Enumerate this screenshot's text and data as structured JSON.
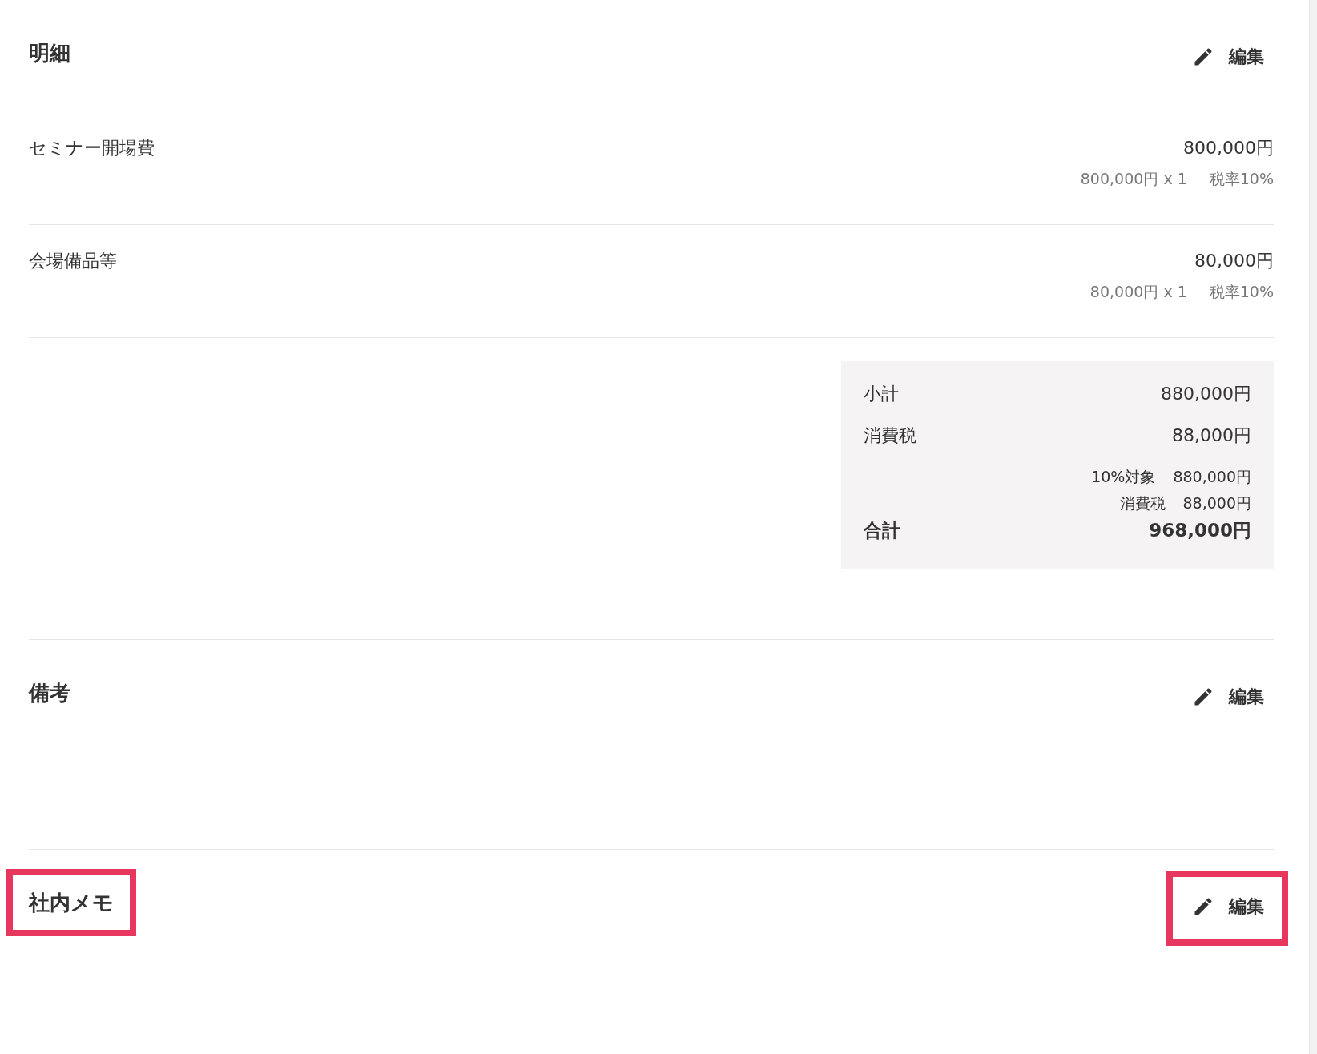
{
  "sections": [
    {
      "kind": "items",
      "title": "明細",
      "edit_label": "編集",
      "highlighted": false,
      "items": [
        {
          "name": "セミナー開場費",
          "amount": "800,000円",
          "detail": "800,000円 x 1",
          "tax_rate": "税率10%"
        },
        {
          "name": "会場備品等",
          "amount": "80,000円",
          "detail": "80,000円 x 1",
          "tax_rate": "税率10%"
        }
      ],
      "totals": {
        "subtotal_label": "小計",
        "subtotal": "880,000円",
        "tax_label": "消費税",
        "tax": "88,000円",
        "breakdown": [
          {
            "label": "10%対象",
            "value": "880,000円"
          },
          {
            "label": "消費税",
            "value": "88,000円"
          }
        ],
        "total_label": "合計",
        "total": "968,000円"
      }
    },
    {
      "kind": "notes",
      "title": "備考",
      "edit_label": "編集",
      "highlighted": false
    },
    {
      "kind": "memo",
      "title": "社内メモ",
      "edit_label": "編集",
      "highlighted": true
    }
  ]
}
